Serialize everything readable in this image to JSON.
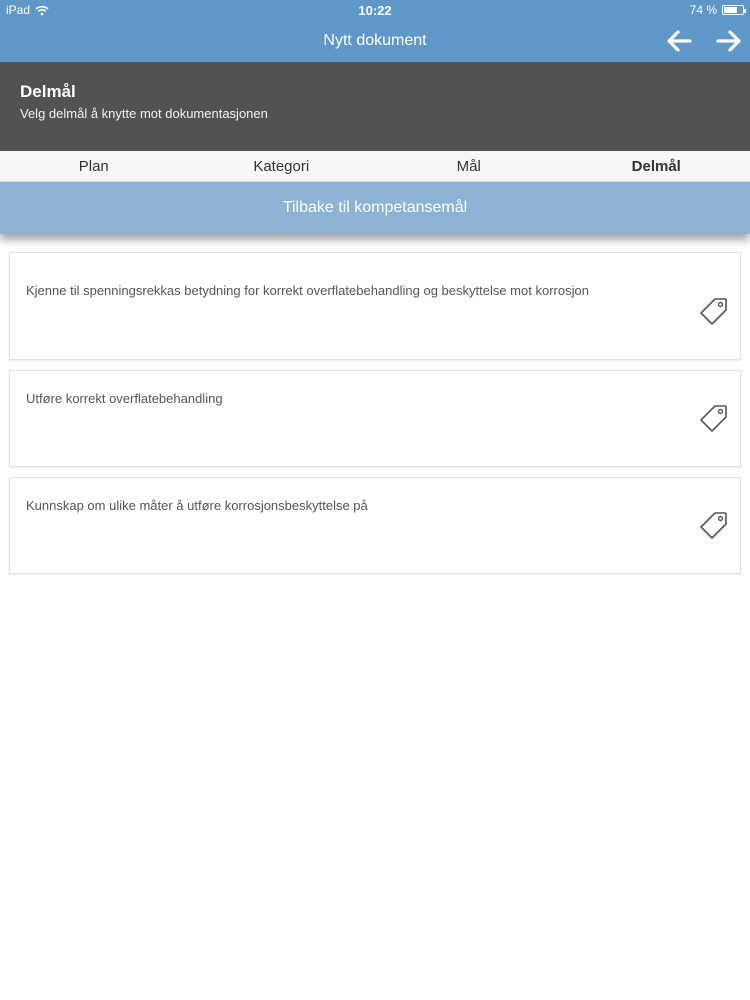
{
  "status": {
    "device": "iPad",
    "time": "10:22",
    "battery": "74 %",
    "battery_level": 0.74
  },
  "nav": {
    "title": "Nytt dokument",
    "back_icon": "arrow-left-icon",
    "forward_icon": "arrow-right-icon"
  },
  "header": {
    "title": "Delmål",
    "subtitle": "Velg delmål å knytte mot dokumentasjonen"
  },
  "tabs": [
    {
      "label": "Plan"
    },
    {
      "label": "Kategori"
    },
    {
      "label": "Mål"
    },
    {
      "label": "Delmål"
    }
  ],
  "back_button": {
    "label": "Tilbake til kompetansemål"
  },
  "items": [
    {
      "text": "Kjenne til spenningsrekkas betydning for korrekt overflatebehandling og beskyttelse mot korrosjon",
      "icon": "tag-icon"
    },
    {
      "text": "Utføre korrekt overflatebehandling",
      "icon": "tag-icon"
    },
    {
      "text": "Kunnskap om ulike måter å utføre korrosjonsbeskyttelse på",
      "icon": "tag-icon"
    }
  ],
  "colors": {
    "nav_bg": "#5f97c9",
    "header_bg": "#525252",
    "back_bar_bg": "#8cb3d6"
  }
}
